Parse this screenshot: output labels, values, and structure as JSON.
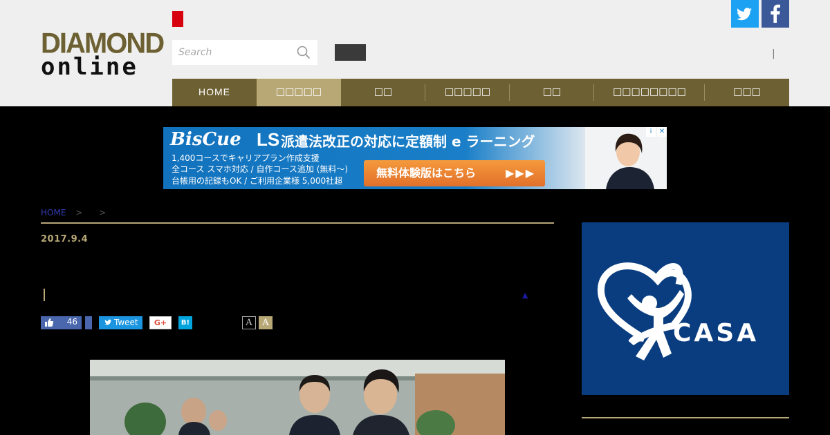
{
  "header": {
    "logo_line1": "DIAMOND",
    "logo_line2": "online",
    "search_placeholder": "Search",
    "separator": "|",
    "brand_color": "#6d6133",
    "accent_color": "#b8a876"
  },
  "nav": {
    "items": [
      {
        "label": "HOME"
      },
      {
        "label": "□□□□□"
      },
      {
        "label": "□□"
      },
      {
        "label": "□□□□□"
      },
      {
        "label": "□□"
      },
      {
        "label": "□□□□□□□□"
      },
      {
        "label": "□□□"
      }
    ]
  },
  "banner_ad": {
    "brand": "BisCue",
    "brand_suffix": "LS",
    "headline": "派遣法改正の対応に定額制 e ラーニング",
    "line1": "1,400コースでキャリアプラン作成支援",
    "line2": "全コース スマホ対応 / 自作コース追加 (無料～)",
    "line3": "台帳用の記録もOK / ご利用企業様 5,000社超",
    "cta": "無料体験版はこちら",
    "cta_arrows": "▶▶▶",
    "adchoices": "i",
    "close": "✕"
  },
  "breadcrumb": {
    "home": "HOME",
    "sep1": ">",
    "sep2": ">"
  },
  "article": {
    "date": "2017.9.4",
    "up_arrow": "▲"
  },
  "share": {
    "like_count": "46",
    "tweet": "Tweet",
    "gplus": "G+",
    "hatena": "B!",
    "font_small": "A",
    "font_large": "A"
  },
  "side_ad": {
    "brand": "CASA",
    "reg": "®"
  }
}
